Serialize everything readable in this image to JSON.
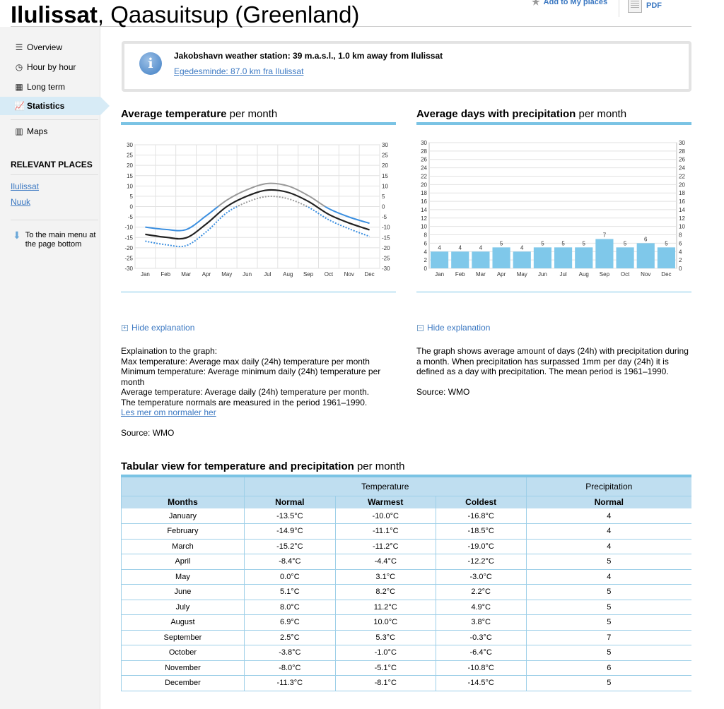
{
  "header": {
    "title_bold": "Ilulissat",
    "title_rest": ", Qaasuitsup (Greenland)",
    "add_places": "Add to My places",
    "forecast_pdf": "Forecast as PDF"
  },
  "sidebar": {
    "items": [
      {
        "label": "Overview",
        "icon": "list-icon"
      },
      {
        "label": "Hour by hour",
        "icon": "clock-icon"
      },
      {
        "label": "Long term",
        "icon": "calendar-icon"
      },
      {
        "label": "Statistics",
        "icon": "statistics-icon"
      },
      {
        "label": "Maps",
        "icon": "map-icon"
      }
    ],
    "relevant_heading": "RELEVANT PLACES",
    "relevant_places": [
      "Ilulissat",
      "Nuuk"
    ],
    "main_menu_link": "To the main menu at the page bottom"
  },
  "station": {
    "name": "Jakobshavn weather station: 39 m.a.s.l., 1.0 km away from Ilulissat",
    "alternative": "Egedesminde: 87.0 km fra Ilulissat"
  },
  "temperature_section": {
    "heading_bold": "Average temperature",
    "heading_rest": " per month",
    "toggle": "Hide explanation",
    "explanation": [
      "Explaination to the graph:",
      "Max temperature: Average max daily (24h) temperature per month",
      "Minimum temperature: Average minimum daily (24h) temperature per month",
      "Average temperature: Average daily (24h) temperature per month.",
      "The temperature normals are measured in the period 1961–1990."
    ],
    "read_more": "Les mer om normaler her",
    "source": "Source: WMO"
  },
  "precip_section": {
    "heading_bold": "Average days with precipitation",
    "heading_rest": " per month",
    "toggle": "Hide explanation",
    "explanation": "The graph shows average amount of days (24h) with precipitation during a month. When precipitation has surpassed 1mm per day (24h) it is defined as a day with precipitation. The mean period is 1961–1990.",
    "source": "Source: WMO"
  },
  "chart_data": [
    {
      "type": "line",
      "categories": [
        "Jan",
        "Feb",
        "Mar",
        "Apr",
        "May",
        "Jun",
        "Jul",
        "Aug",
        "Sep",
        "Oct",
        "Nov",
        "Dec"
      ],
      "ylim": [
        -30,
        30
      ],
      "yticks": [
        30,
        25,
        20,
        15,
        10,
        5,
        0,
        -5,
        -10,
        -15,
        -20,
        -25,
        -30
      ],
      "grid": true,
      "series": [
        {
          "values": [
            -10.0,
            -11.1,
            -11.2,
            -4.4,
            3.1,
            8.2,
            11.2,
            10.0,
            5.3,
            -1.0,
            -5.1,
            -8.1
          ],
          "color": "#999999",
          "color_low": "#3b8fe0",
          "style": "solid"
        },
        {
          "values": [
            -13.5,
            -14.9,
            -15.2,
            -8.4,
            0.0,
            5.1,
            8.0,
            6.9,
            2.5,
            -3.8,
            -8.0,
            -11.3
          ],
          "color": "#222222",
          "style": "solid"
        },
        {
          "values": [
            -16.8,
            -18.5,
            -19.0,
            -12.2,
            -3.0,
            2.2,
            4.9,
            3.8,
            -0.3,
            -6.4,
            -10.8,
            -14.5
          ],
          "color": "#999999",
          "color_low": "#3b8fe0",
          "style": "dotted"
        }
      ]
    },
    {
      "type": "bar",
      "categories": [
        "Jan",
        "Feb",
        "Mar",
        "Apr",
        "May",
        "Jun",
        "Jul",
        "Aug",
        "Sep",
        "Oct",
        "Nov",
        "Dec"
      ],
      "values": [
        4,
        4,
        4,
        5,
        4,
        5,
        5,
        5,
        7,
        5,
        6,
        5
      ],
      "ylim": [
        0,
        30
      ],
      "yticks": [
        30,
        28,
        26,
        24,
        22,
        20,
        18,
        16,
        14,
        12,
        10,
        8,
        6,
        4,
        2,
        0
      ],
      "grid": true,
      "color": "#7fc8ea"
    }
  ],
  "table": {
    "heading_bold": "Tabular view for temperature and precipitation",
    "heading_rest": " per month",
    "group_headers": [
      "Temperature",
      "Precipitation"
    ],
    "columns": [
      "Months",
      "Normal",
      "Warmest",
      "Coldest",
      "Normal"
    ],
    "rows": [
      [
        "January",
        "-13.5°C",
        "-10.0°C",
        "-16.8°C",
        "4"
      ],
      [
        "February",
        "-14.9°C",
        "-11.1°C",
        "-18.5°C",
        "4"
      ],
      [
        "March",
        "-15.2°C",
        "-11.2°C",
        "-19.0°C",
        "4"
      ],
      [
        "April",
        "-8.4°C",
        "-4.4°C",
        "-12.2°C",
        "5"
      ],
      [
        "May",
        "0.0°C",
        "3.1°C",
        "-3.0°C",
        "4"
      ],
      [
        "June",
        "5.1°C",
        "8.2°C",
        "2.2°C",
        "5"
      ],
      [
        "July",
        "8.0°C",
        "11.2°C",
        "4.9°C",
        "5"
      ],
      [
        "August",
        "6.9°C",
        "10.0°C",
        "3.8°C",
        "5"
      ],
      [
        "September",
        "2.5°C",
        "5.3°C",
        "-0.3°C",
        "7"
      ],
      [
        "October",
        "-3.8°C",
        "-1.0°C",
        "-6.4°C",
        "5"
      ],
      [
        "November",
        "-8.0°C",
        "-5.1°C",
        "-10.8°C",
        "6"
      ],
      [
        "December",
        "-11.3°C",
        "-8.1°C",
        "-14.5°C",
        "5"
      ]
    ]
  }
}
